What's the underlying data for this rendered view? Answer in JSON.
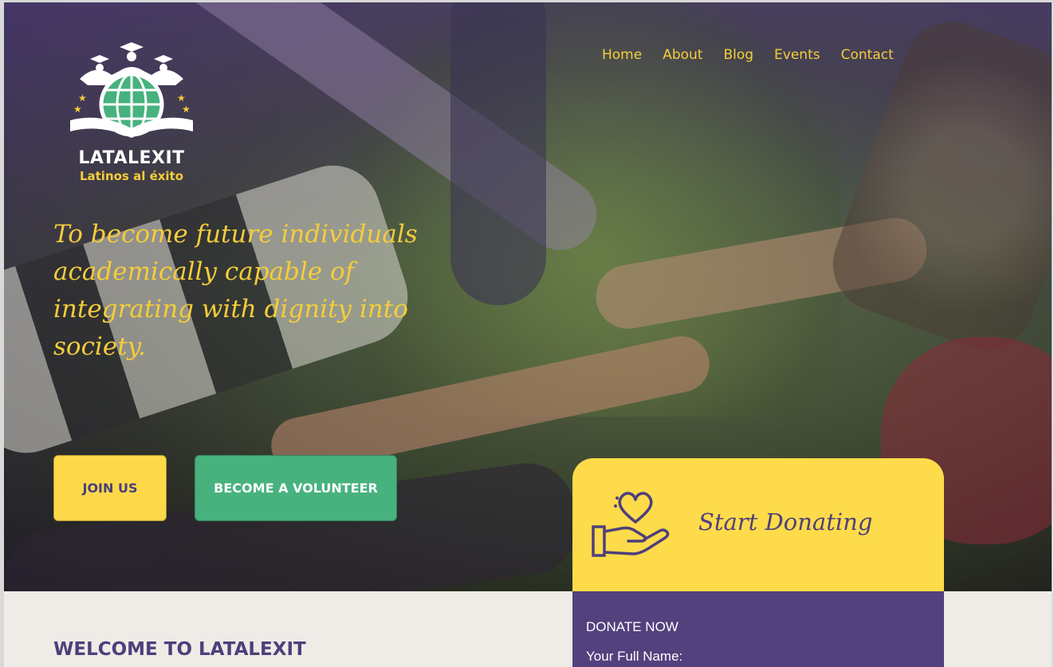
{
  "logo": {
    "title": "LATALEXIT",
    "subtitle": "Latinos al éxito"
  },
  "nav": {
    "items": [
      "Home",
      "About",
      "Blog",
      "Events",
      "Contact"
    ]
  },
  "hero": {
    "tagline": "To become future individuals academically capable of integrating with dignity into society.",
    "join_label": "JOIN US",
    "volunteer_label": "BECOME A VOLUNTEER"
  },
  "donate": {
    "title": "Start Donating",
    "donate_now": "DONATE NOW",
    "full_name_label": "Your Full Name:"
  },
  "welcome": {
    "title": "WELCOME TO LATALEXIT"
  },
  "colors": {
    "accent_yellow": "#fdd94a",
    "brand_purple": "#53417d",
    "green": "#47b27e",
    "background": "#efebe6"
  },
  "icons": [
    "logo-globe-icon",
    "heart-hand-icon"
  ]
}
